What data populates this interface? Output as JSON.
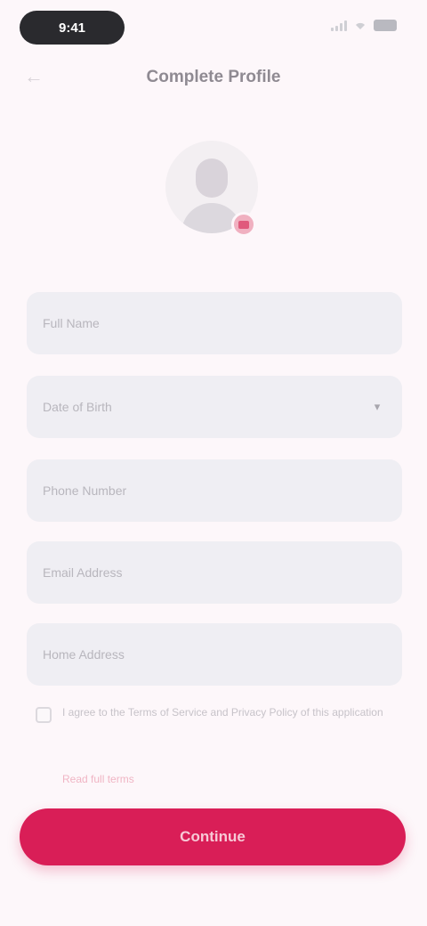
{
  "status_bar": {
    "time": "9:41",
    "icons": [
      "signal-icon",
      "wifi-icon",
      "battery-icon"
    ]
  },
  "header": {
    "back_icon": "back-arrow-icon",
    "title": "Complete Profile"
  },
  "avatar": {
    "icon": "user-silhouette-icon",
    "badge_icon": "camera-icon"
  },
  "form": {
    "fields": [
      {
        "label": "Full Name"
      },
      {
        "label": "Date of Birth",
        "icon": "chevron-down-icon"
      },
      {
        "label": "Phone Number"
      },
      {
        "label": "Email Address"
      },
      {
        "label": "Home Address"
      }
    ],
    "terms_text": "I agree to the Terms of Service and Privacy Policy of this application",
    "link_text": "Read full terms"
  },
  "submit": {
    "label": "Continue"
  },
  "colors": {
    "background": "#fdf7fa",
    "field_bg": "#efeef3",
    "accent": "#d91e57"
  }
}
